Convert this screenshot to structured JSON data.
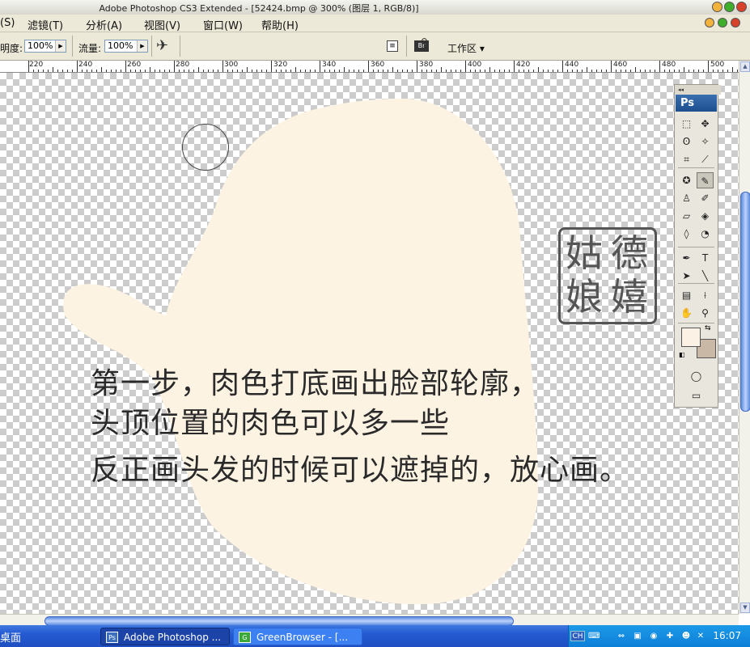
{
  "window": {
    "title": "Adobe Photoshop CS3 Extended - [52424.bmp @ 300% (图层 1, RGB/8)]",
    "colors": {
      "minimize": "#f2b33d",
      "maximize": "#3fae2a",
      "close": "#d8422a"
    }
  },
  "menubar": {
    "items": [
      "(S)",
      "滤镜(T)",
      "分析(A)",
      "视图(V)",
      "窗口(W)",
      "帮助(H)"
    ]
  },
  "options": {
    "opacity_label": "明度:",
    "opacity_value": "100%",
    "flow_label": "流量:",
    "flow_value": "100%",
    "workspace_label": "工作区 ▾",
    "icons": [
      "airbrush-icon",
      "palette-well-icon",
      "bridge-icon"
    ]
  },
  "ruler": {
    "labels": [
      "220",
      "240",
      "260",
      "280",
      "300",
      "320",
      "340",
      "360",
      "380",
      "400",
      "420",
      "440",
      "460",
      "480",
      "500"
    ]
  },
  "canvas": {
    "skin_color": "#fdf3e3",
    "annotation_lines": [
      "第一步，肉色打底画出脸部轮廓，",
      "头顶位置的肉色可以多一些",
      "反正画头发的时候可以遮掉的，放心画。"
    ]
  },
  "seal": {
    "characters": [
      "德",
      "嬉",
      "姑",
      "娘"
    ],
    "color": "#555555"
  },
  "toolbox": {
    "logo": "Ps",
    "grip": "◂◂",
    "tools": [
      {
        "name": "marquee-tool",
        "glyph": "⬚"
      },
      {
        "name": "move-tool",
        "glyph": "✥"
      },
      {
        "name": "lasso-tool",
        "glyph": "ʘ"
      },
      {
        "name": "magic-wand-tool",
        "glyph": "✧"
      },
      {
        "name": "crop-tool",
        "glyph": "⌗"
      },
      {
        "name": "slice-tool",
        "glyph": "⟋"
      },
      {
        "name": "healing-tool",
        "glyph": "✪"
      },
      {
        "name": "brush-tool",
        "glyph": "✎"
      },
      {
        "name": "stamp-tool",
        "glyph": "♙"
      },
      {
        "name": "history-brush-tool",
        "glyph": "✐"
      },
      {
        "name": "eraser-tool",
        "glyph": "▱"
      },
      {
        "name": "bucket-tool",
        "glyph": "◈"
      },
      {
        "name": "blur-tool",
        "glyph": "◊"
      },
      {
        "name": "dodge-tool",
        "glyph": "◔"
      },
      {
        "name": "pen-tool",
        "glyph": "✒"
      },
      {
        "name": "type-tool",
        "glyph": "T"
      },
      {
        "name": "path-select-tool",
        "glyph": "➤"
      },
      {
        "name": "line-tool",
        "glyph": "╲"
      },
      {
        "name": "notes-tool",
        "glyph": "▤"
      },
      {
        "name": "eyedropper-tool",
        "glyph": "⟊"
      },
      {
        "name": "hand-tool",
        "glyph": "✋"
      },
      {
        "name": "zoom-tool",
        "glyph": "⚲"
      }
    ],
    "foreground_color": "#fbf1e4",
    "background_color": "#c9b8a6",
    "quickmask_glyph": "◯",
    "screenmode_glyph": "▭"
  },
  "taskbar": {
    "desktop_label": "桌面",
    "buttons": [
      {
        "label": "Adobe Photoshop ...",
        "icon": "Ps"
      },
      {
        "label": "GreenBrowser - [...",
        "icon": "G"
      }
    ],
    "ime": "CH",
    "tray_icons": [
      "keyboard-icon",
      "network-icon",
      "app-icon",
      "browser-icon",
      "shield-icon",
      "volume-icon"
    ],
    "clock": "16:07"
  }
}
